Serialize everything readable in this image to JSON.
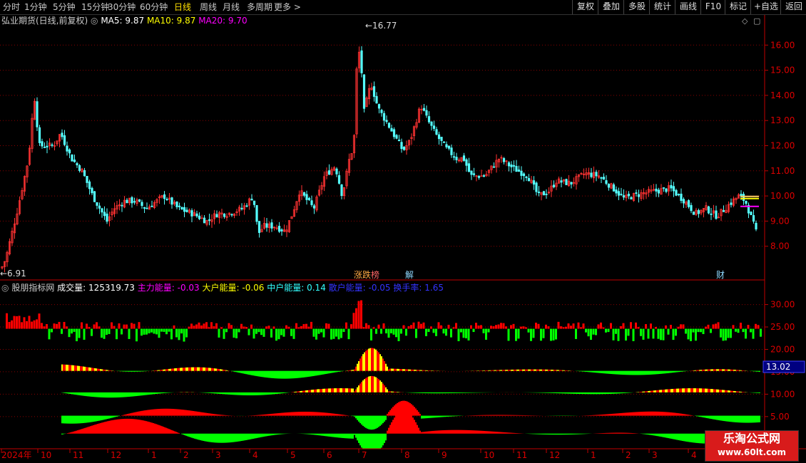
{
  "toolbar": {
    "periods": [
      "分时",
      "1分钟",
      "5分钟",
      "15分钟",
      "30分钟",
      "60分钟",
      "日线",
      "周线",
      "月线",
      "多周期",
      "更多"
    ],
    "active": "日线",
    "right": [
      "复权",
      "叠加",
      "多股",
      "统计",
      "画线",
      "F10",
      "标记",
      "+自选",
      "返回"
    ]
  },
  "main": {
    "title": "弘业期货(日线,前复权)",
    "ma5_label": "MA5: 9.87",
    "ma10_label": "MA10: 9.87",
    "ma20_label": "MA20: 9.70",
    "high_label": "16.77",
    "low_label": "6.91",
    "y_ticks": [
      "16.00",
      "15.00",
      "14.00",
      "13.00",
      "12.00",
      "11.00",
      "10.00",
      "9.00",
      "8.00"
    ],
    "y_values": [
      16,
      15,
      14,
      13,
      12,
      11,
      10,
      9,
      8
    ],
    "markers": [
      {
        "label": "涨跌",
        "color": "#ffaa44"
      },
      {
        "label": "榜",
        "color": "#ff6666"
      },
      {
        "label": "解",
        "color": "#8ed8ff"
      },
      {
        "label": "财",
        "color": "#8ed8ff"
      }
    ]
  },
  "indicator": {
    "title": "股朋指标网",
    "vol_label": "成交量: 125319.73",
    "zl_label": "主力能量: -0.03",
    "dh_label": "大户能量: -0.06",
    "zh_label": "中户能量: 0.14",
    "sh_label": "散户能量: -0.05",
    "hs_label": "换手率: 1.65",
    "y_ticks": [
      "30.00",
      "25.00",
      "20.00",
      "15.00",
      "10.00",
      "5.00"
    ],
    "current_value": "13.02"
  },
  "xaxis": {
    "labels": [
      "2024年",
      "10",
      "11",
      "12",
      "1",
      "2",
      "3",
      "4",
      "5",
      "6",
      "7",
      "8",
      "9",
      "10",
      "11",
      "12",
      "1",
      "2",
      "3",
      "4"
    ]
  },
  "brand": {
    "name": "乐淘公式网",
    "url": "www.60lt.com"
  },
  "colors": {
    "up": "#ff3232",
    "down": "#54ffff",
    "axis": "#c00000",
    "ma5": "#ffffff",
    "ma10": "#ffff00",
    "ma20": "#ff00ff",
    "green": "#00ff00",
    "yellow": "#ffff00",
    "red": "#ff0000"
  },
  "chart_data": {
    "type": "candlestick",
    "price_key_points": [
      [
        0,
        7.0
      ],
      [
        8,
        7.5
      ],
      [
        25,
        9.5
      ],
      [
        40,
        11.5
      ],
      [
        48,
        14.0
      ],
      [
        55,
        12.0
      ],
      [
        75,
        12.0
      ],
      [
        85,
        12.5
      ],
      [
        100,
        11.5
      ],
      [
        115,
        11.0
      ],
      [
        130,
        10.0
      ],
      [
        150,
        9.0
      ],
      [
        160,
        9.5
      ],
      [
        175,
        9.8
      ],
      [
        190,
        9.8
      ],
      [
        205,
        9.5
      ],
      [
        230,
        10.0
      ],
      [
        250,
        9.5
      ],
      [
        270,
        9.3
      ],
      [
        290,
        9.0
      ],
      [
        305,
        9.3
      ],
      [
        320,
        9.3
      ],
      [
        340,
        9.5
      ],
      [
        355,
        10.0
      ],
      [
        362,
        8.5
      ],
      [
        370,
        8.8
      ],
      [
        385,
        8.8
      ],
      [
        400,
        8.6
      ],
      [
        410,
        9.3
      ],
      [
        420,
        10.2
      ],
      [
        440,
        9.5
      ],
      [
        455,
        10.8
      ],
      [
        470,
        11.2
      ],
      [
        480,
        10.0
      ],
      [
        490,
        11.5
      ],
      [
        496,
        12.0
      ],
      [
        500,
        15.0
      ],
      [
        505,
        16.0
      ],
      [
        510,
        13.3
      ],
      [
        520,
        14.5
      ],
      [
        530,
        13.5
      ],
      [
        545,
        12.8
      ],
      [
        565,
        11.8
      ],
      [
        575,
        12.2
      ],
      [
        590,
        13.6
      ],
      [
        600,
        13.0
      ],
      [
        610,
        12.5
      ],
      [
        625,
        11.9
      ],
      [
        640,
        11.5
      ],
      [
        650,
        11.5
      ],
      [
        660,
        10.8
      ],
      [
        680,
        10.8
      ],
      [
        700,
        11.5
      ],
      [
        720,
        11.1
      ],
      [
        740,
        10.8
      ],
      [
        755,
        10.0
      ],
      [
        770,
        10.2
      ],
      [
        780,
        10.6
      ],
      [
        800,
        10.5
      ],
      [
        820,
        10.9
      ],
      [
        840,
        10.8
      ],
      [
        860,
        10.3
      ],
      [
        875,
        9.9
      ],
      [
        900,
        10.1
      ],
      [
        920,
        10.2
      ],
      [
        940,
        10.3
      ],
      [
        960,
        9.8
      ],
      [
        975,
        9.3
      ],
      [
        990,
        9.5
      ],
      [
        1005,
        9.2
      ],
      [
        1020,
        9.6
      ],
      [
        1035,
        10.0
      ],
      [
        1045,
        9.8
      ],
      [
        1055,
        9.0
      ],
      [
        1062,
        8.4
      ]
    ],
    "ma5": 9.87,
    "ma10": 9.87,
    "ma20": 9.7,
    "high": 16.77,
    "low": 6.91,
    "ylim": [
      7.0,
      17.0
    ]
  }
}
